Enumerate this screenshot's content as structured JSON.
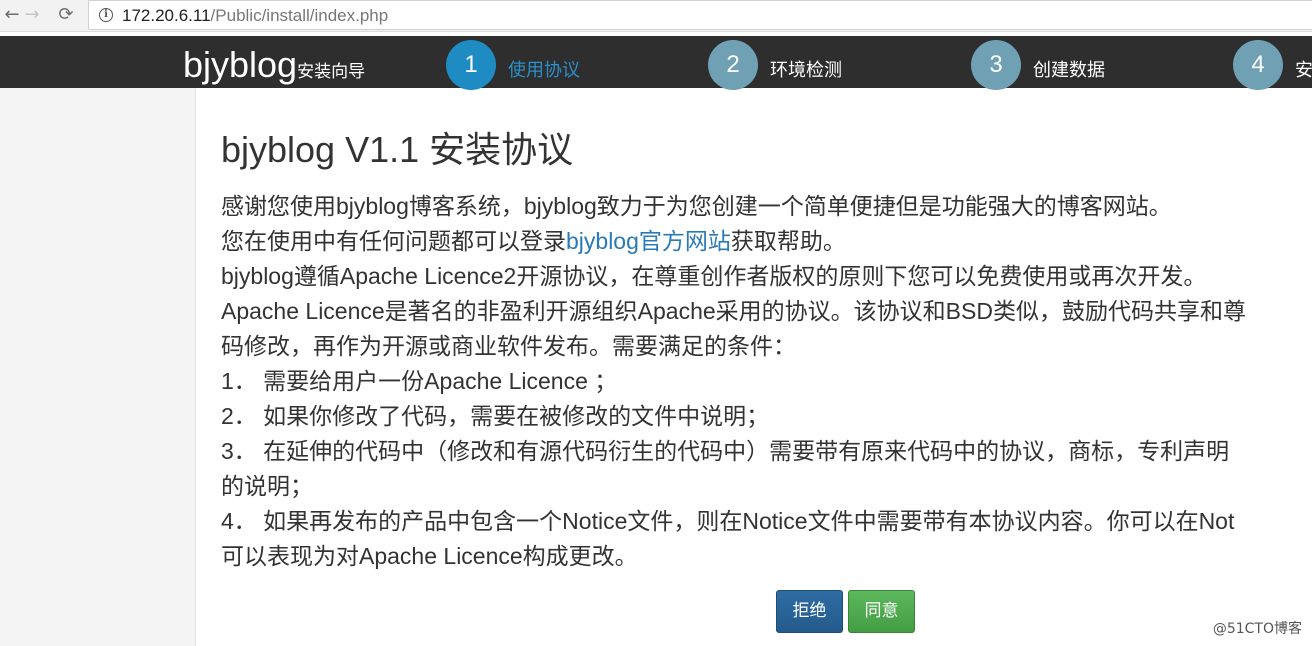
{
  "browser": {
    "back_icon": "←",
    "forward_icon": "→",
    "reload_icon": "⟳",
    "info_icon": "i",
    "url_host": "172.20.6.11",
    "url_path": "/Public/install/index.php"
  },
  "header": {
    "brand_name": "bjyblog",
    "brand_sub": "安装向导",
    "steps": [
      {
        "number": "1",
        "label": "使用协议"
      },
      {
        "number": "2",
        "label": "环境检测"
      },
      {
        "number": "3",
        "label": "创建数据"
      },
      {
        "number": "4",
        "label": "安"
      }
    ]
  },
  "content": {
    "title": "bjyblog V1.1 安装协议",
    "line1": "感谢您使用bjyblog博客系统，bjyblog致力于为您创建一个简单便捷但是功能强大的博客网站。",
    "line2_before": "您在使用中有任何问题都可以登录",
    "line2_link": "bjyblog官方网站",
    "line2_after": "获取帮助。",
    "line3": "bjyblog遵循Apache Licence2开源协议，在尊重创作者版权的原则下您可以免费使用或再次开发。",
    "line4": "Apache Licence是著名的非盈利开源组织Apache采用的协议。该协议和BSD类似，鼓励代码共享和尊",
    "line5": "码修改，再作为开源或商业软件发布。需要满足的条件：",
    "line6": "1． 需要给用户一份Apache Licence ；",
    "line7": "2． 如果你修改了代码，需要在被修改的文件中说明；",
    "line8": "3． 在延伸的代码中（修改和有源代码衍生的代码中）需要带有原来代码中的协议，商标，专利声明",
    "line9": "的说明；",
    "line10": "4． 如果再发布的产品中包含一个Notice文件，则在Notice文件中需要带有本协议内容。你可以在Not",
    "line11": "可以表现为对Apache Licence构成更改。",
    "reject_label": "拒绝",
    "agree_label": "同意"
  },
  "watermark": "@51CTO博客"
}
